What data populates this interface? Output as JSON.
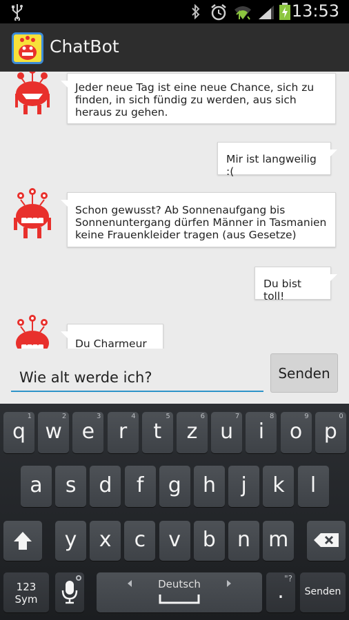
{
  "status_bar": {
    "time": "13:53"
  },
  "app": {
    "title": "ChatBot"
  },
  "messages": [
    {
      "side": "bot",
      "lines": [
        "Jeder neue Tag ist eine neue Chance, sich zu",
        "finden, in sich fündig zu werden, aus sich",
        "heraus zu gehen."
      ]
    },
    {
      "side": "user",
      "lines": [
        "Mir ist langweilig :("
      ]
    },
    {
      "side": "bot",
      "lines": [
        "Schon gewusst? Ab Sonnenaufgang bis",
        "Sonnenuntergang dürfen Männer in Tasmanien",
        "keine Frauenkleider tragen (aus Gesetze)"
      ]
    },
    {
      "side": "user",
      "lines": [
        "Du bist toll!"
      ]
    },
    {
      "side": "bot",
      "lines": [
        "Du Charmeur :)"
      ]
    }
  ],
  "composer": {
    "input_value": "Wie alt werde ich?",
    "send_label": "Senden"
  },
  "keyboard": {
    "row1": [
      {
        "k": "q",
        "h": "1"
      },
      {
        "k": "w",
        "h": "2"
      },
      {
        "k": "e",
        "h": "3"
      },
      {
        "k": "r",
        "h": "4"
      },
      {
        "k": "t",
        "h": "5"
      },
      {
        "k": "z",
        "h": "6"
      },
      {
        "k": "u",
        "h": "7"
      },
      {
        "k": "i",
        "h": "8"
      },
      {
        "k": "o",
        "h": "9"
      },
      {
        "k": "p",
        "h": "0"
      }
    ],
    "row2": [
      "a",
      "s",
      "d",
      "f",
      "g",
      "h",
      "j",
      "k",
      "l"
    ],
    "row3": [
      "y",
      "x",
      "c",
      "v",
      "b",
      "n",
      "m"
    ],
    "sym_label_1": "123",
    "sym_label_2": "Sym",
    "space_label": "Deutsch",
    "punct_hint": "\"?",
    "punct_main": ".",
    "enter_label": "Senden"
  },
  "colors": {
    "accent": "#2d93c9",
    "actionbar": "#2d2d2d",
    "chat_bg": "#ebebeb",
    "robot_red": "#e8302c"
  }
}
